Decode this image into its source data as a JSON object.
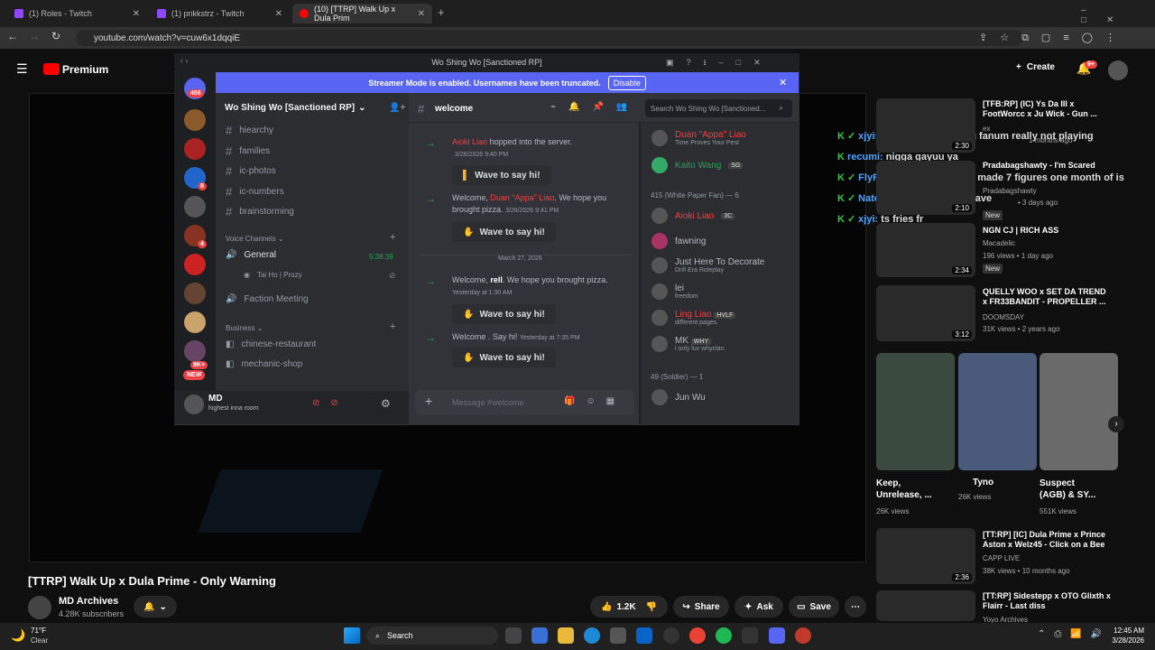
{
  "browser": {
    "tabs": [
      {
        "label": "(1) Roles - Twitch"
      },
      {
        "label": "(1) pnkkstrz - Twitch"
      },
      {
        "label": "(10) [TTRP] Walk Up x Dula Prim"
      }
    ],
    "url": "youtube.com/watch?v=cuw6x1dqqiE"
  },
  "youtube": {
    "brand": "Premium",
    "create_label": "Create",
    "notif_badge": "9+",
    "video_title": "[TTRP] Walk Up x Dula Prime - Only Warning",
    "channel_name": "MD Archives",
    "subscribers": "4.28K subscribers",
    "likes": "1.2K",
    "share_label": "Share",
    "ask_label": "Ask",
    "save_label": "Save",
    "sidebar": [
      {
        "title": "[TFB:RP] (IC) Ys Da III x FootWorcc x Ju Wick - Gun ...",
        "meta1": "ex",
        "meta2": "1 months ago",
        "dur": "2:30"
      },
      {
        "title": "Pradabagshawty - I'm Scared",
        "meta1": "Pradabagshawty",
        "meta2": "• 3 days ago",
        "dur": "2:10",
        "badge": "New"
      },
      {
        "title": "NGN CJ | RICH ASS",
        "meta1": "Macadelic",
        "meta2": "196 views • 1 day ago",
        "dur": "2:34",
        "badge": "New"
      },
      {
        "title": "QUELLY WOO x SET DA TREND x FR33BANDIT - PROPELLER ...",
        "meta1": "DOOMSDAY",
        "meta2": "31K views • 2 years ago",
        "dur": "3:12"
      }
    ],
    "shorts": [
      {
        "title": "Keep, Unrelease, ...",
        "views": "26K views"
      },
      {
        "title": "Tyno",
        "views": "26K views"
      },
      {
        "title": "Suspect (AGB) & SY...",
        "views": "551K views"
      }
    ],
    "sidebar2": [
      {
        "title": "[TT:RP] [IC] Dula Prime x Prince Aston x Welz45 - Click on a Bee",
        "meta1": "CAPP LIVE",
        "meta2": "38K views • 10 months ago",
        "dur": "2:36"
      },
      {
        "title": "[TT:RP] Sidestepp x OTO Glixth x Flairr - Last diss",
        "meta1": "Yoyo Archives",
        "meta2": ""
      }
    ]
  },
  "chat_overlay": [
    {
      "user": "xjyi:",
      "text": "damn niggas saying fanum really not playing"
    },
    {
      "user": "recumi:",
      "text": "nigga gayuu ya"
    },
    {
      "user": "FlyRacks:",
      "text": "fanum said he made 7 figures one month of is"
    },
    {
      "user": "NateBreaz:",
      "text": "300 to be a slave"
    },
    {
      "user": "xjyi:",
      "text": "ts fries fr"
    }
  ],
  "discord": {
    "window_title": "Wo Shing Wo [Sanctioned RP]",
    "banner_text": "Streamer Mode is enabled. Usernames have been truncated.",
    "banner_button": "Disable",
    "server_name": "Wo Shing Wo [Sanctioned RP]",
    "guild_badges": [
      "456",
      "8",
      "4",
      "9K+",
      "NEW"
    ],
    "channels": [
      "hiearchy",
      "families",
      "ic-photos",
      "ic-numbers",
      "brainstorming"
    ],
    "voice_category": "Voice Channels",
    "voice_general": "General",
    "voice_timer": "5:38:39",
    "voice_user": "Tai Ho | Prozy",
    "faction_meeting": "Faction Meeting",
    "business_category": "Business",
    "business_channels": [
      "chinese-restaurant",
      "mechanic-shop"
    ],
    "user_name": "MD",
    "user_status": "highest inna room",
    "channel_header": "welcome",
    "search_placeholder": "Search Wo Shing Wo [Sanctioned...",
    "message_placeholder": "Message #welcome",
    "messages": [
      {
        "name": "Aioki Liao",
        "text": " hopped into the server.",
        "ts": "3/26/2026 9:40 PM",
        "wave": "Wave to say hi!"
      },
      {
        "prefix": "Welcome, ",
        "name": "Duan \"Appa\" Liao",
        "text": ". We hope you brought pizza.",
        "ts": "3/26/2026 9:41 PM",
        "wave": "Wave to say hi!"
      },
      {
        "prefix": "Welcome, ",
        "name": "rell",
        "text": ". We hope you brought pizza.",
        "ts": "Yesterday at 1:30 AM",
        "wave": "Wave to say hi!"
      },
      {
        "prefix": "Welcome ",
        "name": "",
        "text": ". Say hi!",
        "ts": "Yesterday at 7:35 PM",
        "wave": "Wave to say hi!"
      }
    ],
    "date_divider": "March 27, 2026",
    "members": {
      "top": [
        {
          "name": "Duan \"Appa\" Liao",
          "status": "Time Proves Your Pest",
          "color": "#f23f43"
        },
        {
          "name": "Kaito Wang",
          "tag": "SG",
          "color": "#23a55a"
        }
      ],
      "cat1": "415 (White Paper Fan) — 6",
      "cat1_list": [
        {
          "name": "Aioki Liao",
          "tag": "3C",
          "color": "#f23f43"
        },
        {
          "name": "fawning",
          "color": "#b5bac1"
        },
        {
          "name": "Just Here To Decorate",
          "status": "Drill Era Roleplay",
          "color": "#b5bac1"
        },
        {
          "name": "lei",
          "status": "freedom",
          "color": "#b5bac1"
        },
        {
          "name": "Ling Liao",
          "tag": "HVLF",
          "status": "different pages.",
          "color": "#f23f43"
        },
        {
          "name": "MK",
          "tag": "WHY",
          "status": "i only luv whyclan.",
          "color": "#b5bac1"
        }
      ],
      "cat2": "49 (Soldier) — 1",
      "cat2_list": [
        {
          "name": "Jun Wu",
          "color": "#b5bac1"
        }
      ]
    }
  },
  "taskbar": {
    "weather_temp": "71°F",
    "weather_desc": "Clear",
    "search_label": "Search",
    "time": "12:45 AM",
    "date": "3/28/2026"
  }
}
